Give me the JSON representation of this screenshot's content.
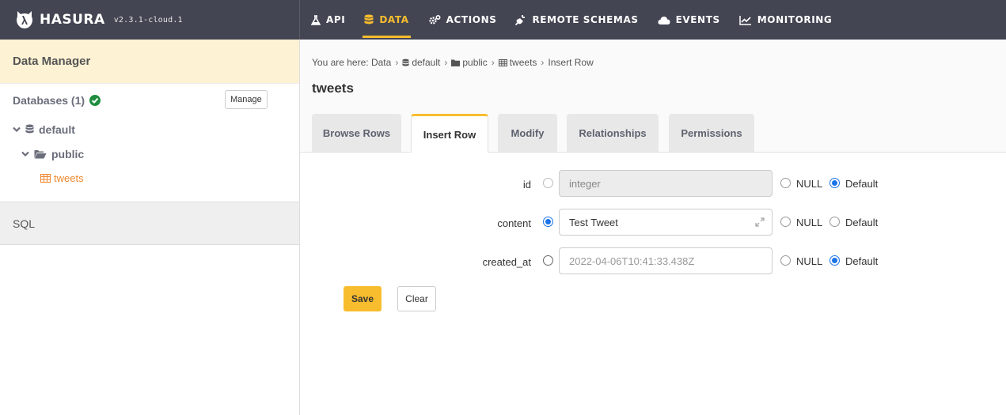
{
  "app": {
    "brand_name": "HASURA",
    "version": "v2.3.1-cloud.1"
  },
  "nav": {
    "items": [
      {
        "label": "API",
        "icon": "flask-icon",
        "active": false
      },
      {
        "label": "DATA",
        "icon": "database-icon",
        "active": true
      },
      {
        "label": "ACTIONS",
        "icon": "cogs-icon",
        "active": false
      },
      {
        "label": "REMOTE SCHEMAS",
        "icon": "plug-icon",
        "active": false
      },
      {
        "label": "EVENTS",
        "icon": "cloud-icon",
        "active": false
      },
      {
        "label": "MONITORING",
        "icon": "line-chart-icon",
        "active": false
      }
    ],
    "accent": "#f8bd2e"
  },
  "sidebar": {
    "title": "Data Manager",
    "databases_label": "Databases (1)",
    "manage_label": "Manage",
    "tree": {
      "database": "default",
      "schema": "public",
      "table": "tweets"
    },
    "sql_label": "SQL"
  },
  "breadcrumb": {
    "prefix": "You are here:",
    "items": [
      "Data",
      "default",
      "public",
      "tweets",
      "Insert Row"
    ]
  },
  "page": {
    "title": "tweets"
  },
  "tabs": [
    {
      "label": "Browse Rows",
      "active": false
    },
    {
      "label": "Insert Row",
      "active": true
    },
    {
      "label": "Modify",
      "active": false
    },
    {
      "label": "Relationships",
      "active": false
    },
    {
      "label": "Permissions",
      "active": false
    }
  ],
  "form": {
    "fields": [
      {
        "name": "id",
        "value_selected": false,
        "value": "",
        "placeholder": "integer",
        "disabled": true,
        "null_label": "NULL",
        "default_label": "Default",
        "selected_option": "Default"
      },
      {
        "name": "content",
        "value_selected": true,
        "value": "Test Tweet",
        "placeholder": "",
        "disabled": false,
        "null_label": "NULL",
        "default_label": "Default",
        "selected_option": "value"
      },
      {
        "name": "created_at",
        "value_selected": false,
        "value": "",
        "placeholder": "2022-04-06T10:41:33.438Z",
        "disabled": false,
        "null_label": "NULL",
        "default_label": "Default",
        "selected_option": "Default"
      }
    ],
    "save_label": "Save",
    "clear_label": "Clear"
  }
}
